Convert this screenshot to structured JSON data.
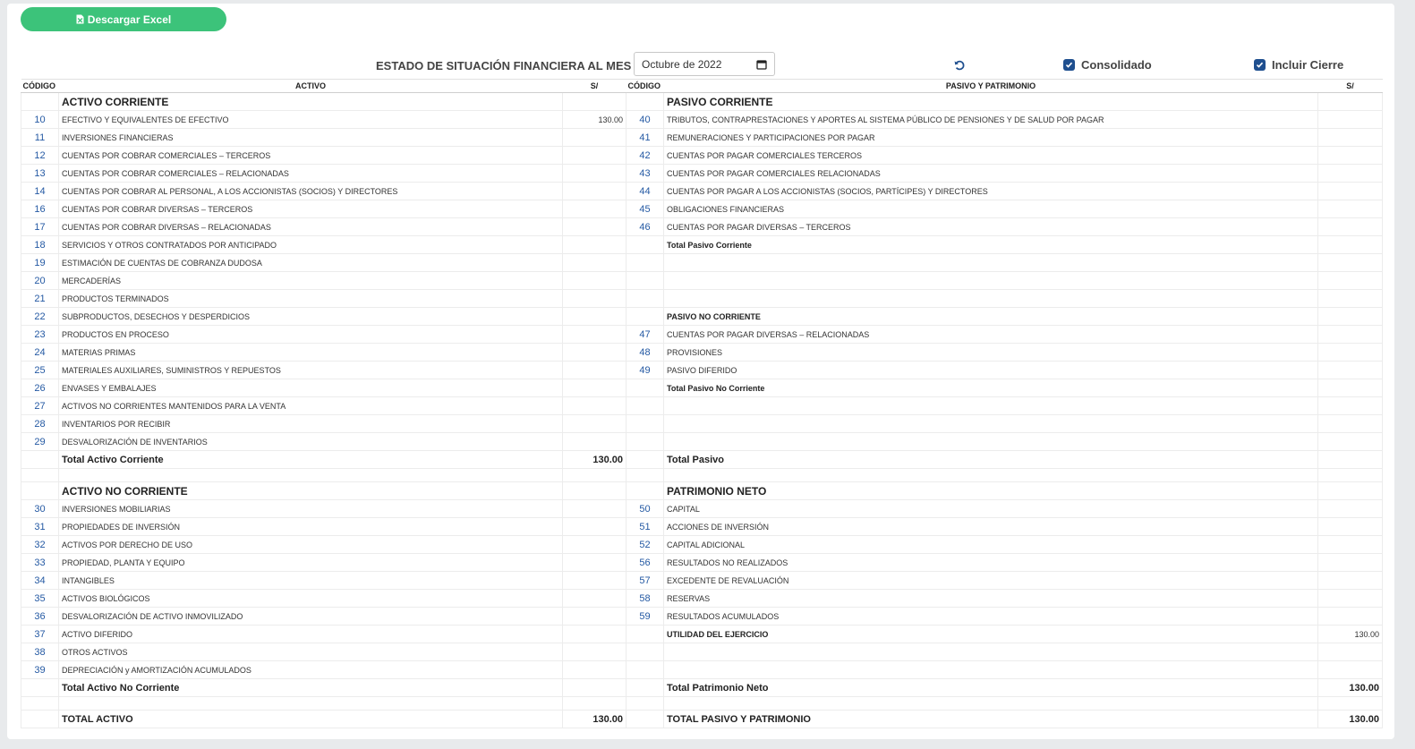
{
  "toolbar": {
    "excel_label": "Descargar Excel",
    "title": "ESTADO DE SITUACIÓN FINANCIERA AL MES DE",
    "date_value": "Octubre de 2022",
    "consolidado_label": "Consolidado",
    "incluir_cierre_label": "Incluir Cierre"
  },
  "colors": {
    "accent": "#3cc37a",
    "primary": "#1f4f8f",
    "code": "#2459a3"
  },
  "table": {
    "headers": {
      "codigo": "CÓDIGO",
      "activo": "ACTIVO",
      "currency": "S/",
      "pasivo": "PASIVO Y PATRIMONIO"
    },
    "rows": [
      {
        "cls": "",
        "lc": "",
        "ln": "ACTIVO CORRIENTE",
        "lt": "sec",
        "la": "",
        "rc": "",
        "rn": "PASIVO CORRIENTE",
        "rt": "sec",
        "ra": ""
      },
      {
        "cls": "",
        "lc": "10",
        "ln": "EFECTIVO Y EQUIVALENTES DE EFECTIVO",
        "lt": "",
        "la": "130.00",
        "rc": "40",
        "rn": "TRIBUTOS, CONTRAPRESTACIONES Y APORTES AL SISTEMA PÚBLICO DE PENSIONES Y DE SALUD POR PAGAR",
        "rt": "",
        "ra": ""
      },
      {
        "cls": "",
        "lc": "11",
        "ln": "INVERSIONES FINANCIERAS",
        "lt": "",
        "la": "",
        "rc": "41",
        "rn": "REMUNERACIONES Y PARTICIPACIONES POR PAGAR",
        "rt": "",
        "ra": ""
      },
      {
        "cls": "",
        "lc": "12",
        "ln": "CUENTAS POR COBRAR COMERCIALES – TERCEROS",
        "lt": "",
        "la": "",
        "rc": "42",
        "rn": "CUENTAS POR PAGAR COMERCIALES TERCEROS",
        "rt": "",
        "ra": ""
      },
      {
        "cls": "",
        "lc": "13",
        "ln": "CUENTAS POR COBRAR COMERCIALES – RELACIONADAS",
        "lt": "",
        "la": "",
        "rc": "43",
        "rn": "CUENTAS POR PAGAR COMERCIALES RELACIONADAS",
        "rt": "",
        "ra": ""
      },
      {
        "cls": "",
        "lc": "14",
        "ln": "CUENTAS POR COBRAR AL PERSONAL, A LOS ACCIONISTAS (SOCIOS) Y DIRECTORES",
        "lt": "",
        "la": "",
        "rc": "44",
        "rn": "CUENTAS POR PAGAR A LOS ACCIONISTAS (SOCIOS, PARTÍCIPES) Y DIRECTORES",
        "rt": "",
        "ra": ""
      },
      {
        "cls": "",
        "lc": "16",
        "ln": "CUENTAS POR COBRAR DIVERSAS – TERCEROS",
        "lt": "",
        "la": "",
        "rc": "45",
        "rn": "OBLIGACIONES FINANCIERAS",
        "rt": "",
        "ra": ""
      },
      {
        "cls": "",
        "lc": "17",
        "ln": "CUENTAS POR COBRAR DIVERSAS – RELACIONADAS",
        "lt": "",
        "la": "",
        "rc": "46",
        "rn": "CUENTAS POR PAGAR DIVERSAS – TERCEROS",
        "rt": "",
        "ra": ""
      },
      {
        "cls": "",
        "lc": "18",
        "ln": "SERVICIOS Y OTROS CONTRATADOS POR ANTICIPADO",
        "lt": "",
        "la": "",
        "rc": "",
        "rn": "Total Pasivo Corriente",
        "rt": "sub",
        "ra": ""
      },
      {
        "cls": "",
        "lc": "19",
        "ln": "ESTIMACIÓN DE CUENTAS DE COBRANZA DUDOSA",
        "lt": "",
        "la": "",
        "rc": "",
        "rn": "",
        "rt": "",
        "ra": ""
      },
      {
        "cls": "",
        "lc": "20",
        "ln": "MERCADERÍAS",
        "lt": "",
        "la": "",
        "rc": "",
        "rn": "",
        "rt": "",
        "ra": ""
      },
      {
        "cls": "",
        "lc": "21",
        "ln": "PRODUCTOS TERMINADOS",
        "lt": "",
        "la": "",
        "rc": "",
        "rn": "",
        "rt": "",
        "ra": ""
      },
      {
        "cls": "",
        "lc": "22",
        "ln": "SUBPRODUCTOS, DESECHOS Y DESPERDICIOS",
        "lt": "",
        "la": "",
        "rc": "",
        "rn": "PASIVO NO CORRIENTE",
        "rt": "sub",
        "ra": ""
      },
      {
        "cls": "",
        "lc": "23",
        "ln": "PRODUCTOS EN PROCESO",
        "lt": "",
        "la": "",
        "rc": "47",
        "rn": "CUENTAS POR PAGAR DIVERSAS – RELACIONADAS",
        "rt": "",
        "ra": ""
      },
      {
        "cls": "",
        "lc": "24",
        "ln": "MATERIAS PRIMAS",
        "lt": "",
        "la": "",
        "rc": "48",
        "rn": "PROVISIONES",
        "rt": "",
        "ra": ""
      },
      {
        "cls": "",
        "lc": "25",
        "ln": "MATERIALES AUXILIARES, SUMINISTROS Y REPUESTOS",
        "lt": "",
        "la": "",
        "rc": "49",
        "rn": "PASIVO DIFERIDO",
        "rt": "",
        "ra": ""
      },
      {
        "cls": "",
        "lc": "26",
        "ln": "ENVASES Y EMBALAJES",
        "lt": "",
        "la": "",
        "rc": "",
        "rn": "Total Pasivo No Corriente",
        "rt": "sub",
        "ra": ""
      },
      {
        "cls": "",
        "lc": "27",
        "ln": "ACTIVOS NO CORRIENTES MANTENIDOS PARA LA VENTA",
        "lt": "",
        "la": "",
        "rc": "",
        "rn": "",
        "rt": "",
        "ra": ""
      },
      {
        "cls": "",
        "lc": "28",
        "ln": "INVENTARIOS POR RECIBIR",
        "lt": "",
        "la": "",
        "rc": "",
        "rn": "",
        "rt": "",
        "ra": ""
      },
      {
        "cls": "",
        "lc": "29",
        "ln": "DESVALORIZACIÓN DE INVENTARIOS",
        "lt": "",
        "la": "",
        "rc": "",
        "rn": "",
        "rt": "",
        "ra": ""
      },
      {
        "cls": "",
        "lc": "",
        "ln": "Total Activo Corriente",
        "lt": "tot",
        "la": "130.00",
        "rc": "",
        "rn": "Total Pasivo",
        "rt": "tot",
        "ra": ""
      },
      {
        "cls": "spacer",
        "lc": "",
        "ln": "",
        "lt": "",
        "la": "",
        "rc": "",
        "rn": "",
        "rt": "",
        "ra": ""
      },
      {
        "cls": "",
        "lc": "",
        "ln": "ACTIVO NO CORRIENTE",
        "lt": "sec",
        "la": "",
        "rc": "",
        "rn": "PATRIMONIO NETO",
        "rt": "sec",
        "ra": ""
      },
      {
        "cls": "",
        "lc": "30",
        "ln": "INVERSIONES MOBILIARIAS",
        "lt": "",
        "la": "",
        "rc": "50",
        "rn": "CAPITAL",
        "rt": "",
        "ra": ""
      },
      {
        "cls": "",
        "lc": "31",
        "ln": "PROPIEDADES DE INVERSIÓN",
        "lt": "",
        "la": "",
        "rc": "51",
        "rn": "ACCIONES DE INVERSIÓN",
        "rt": "",
        "ra": ""
      },
      {
        "cls": "",
        "lc": "32",
        "ln": "ACTIVOS POR DERECHO DE USO",
        "lt": "",
        "la": "",
        "rc": "52",
        "rn": "CAPITAL ADICIONAL",
        "rt": "",
        "ra": ""
      },
      {
        "cls": "",
        "lc": "33",
        "ln": "PROPIEDAD, PLANTA Y EQUIPO",
        "lt": "",
        "la": "",
        "rc": "56",
        "rn": "RESULTADOS NO REALIZADOS",
        "rt": "",
        "ra": ""
      },
      {
        "cls": "",
        "lc": "34",
        "ln": "INTANGIBLES",
        "lt": "",
        "la": "",
        "rc": "57",
        "rn": "EXCEDENTE DE REVALUACIÓN",
        "rt": "",
        "ra": ""
      },
      {
        "cls": "",
        "lc": "35",
        "ln": "ACTIVOS BIOLÓGICOS",
        "lt": "",
        "la": "",
        "rc": "58",
        "rn": "RESERVAS",
        "rt": "",
        "ra": ""
      },
      {
        "cls": "",
        "lc": "36",
        "ln": "DESVALORIZACIÓN DE ACTIVO INMOVILIZADO",
        "lt": "",
        "la": "",
        "rc": "59",
        "rn": "RESULTADOS ACUMULADOS",
        "rt": "",
        "ra": ""
      },
      {
        "cls": "",
        "lc": "37",
        "ln": "ACTIVO DIFERIDO",
        "lt": "",
        "la": "",
        "rc": "",
        "rn": "UTILIDAD DEL EJERCICIO",
        "rt": "sub",
        "ra": "130.00"
      },
      {
        "cls": "",
        "lc": "38",
        "ln": "OTROS ACTIVOS",
        "lt": "",
        "la": "",
        "rc": "",
        "rn": "",
        "rt": "",
        "ra": ""
      },
      {
        "cls": "",
        "lc": "39",
        "ln": "DEPRECIACIÓN y AMORTIZACIÓN ACUMULADOS",
        "lt": "",
        "la": "",
        "rc": "",
        "rn": "",
        "rt": "",
        "ra": ""
      },
      {
        "cls": "",
        "lc": "",
        "ln": "Total Activo No Corriente",
        "lt": "tot",
        "la": "",
        "rc": "",
        "rn": "Total Patrimonio Neto",
        "rt": "tot",
        "ra": "130.00"
      },
      {
        "cls": "spacer",
        "lc": "",
        "ln": "",
        "lt": "",
        "la": "",
        "rc": "",
        "rn": "",
        "rt": "",
        "ra": ""
      },
      {
        "cls": "",
        "lc": "",
        "ln": "TOTAL ACTIVO",
        "lt": "tot",
        "la": "130.00",
        "rc": "",
        "rn": "TOTAL PASIVO Y PATRIMONIO",
        "rt": "tot",
        "ra": "130.00"
      }
    ]
  }
}
